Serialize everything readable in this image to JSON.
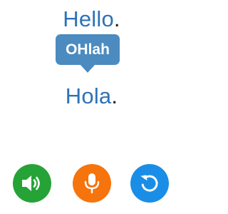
{
  "phrase": {
    "source_word": "Hello",
    "source_punct": ".",
    "pronunciation": "OHlah",
    "translated_word": "Hola",
    "translated_punct": "."
  },
  "colors": {
    "word_blue": "#2d72b8",
    "bubble_blue": "#4b8bbf",
    "speaker_green": "#25a336",
    "mic_orange": "#f5740d",
    "replay_blue": "#1a8ee6"
  },
  "buttons": [
    {
      "id": "speaker",
      "icon": "speaker-volume-icon"
    },
    {
      "id": "mic",
      "icon": "microphone-icon"
    },
    {
      "id": "replay",
      "icon": "replay-icon"
    }
  ]
}
